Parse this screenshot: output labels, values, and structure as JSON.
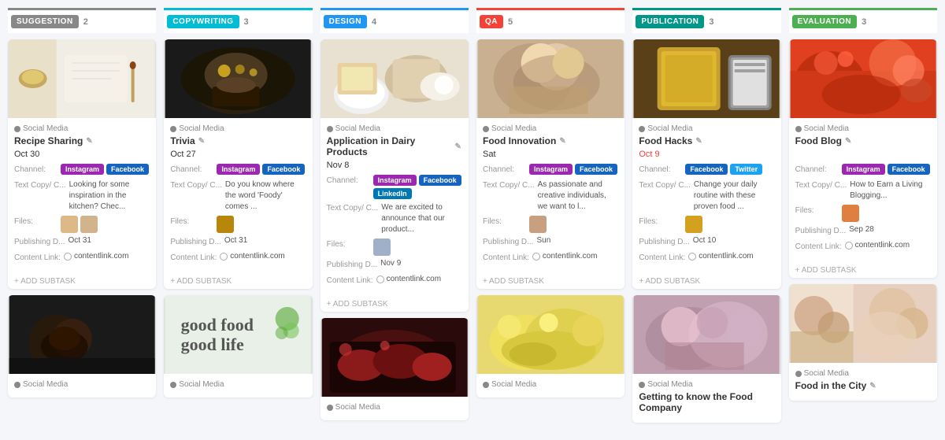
{
  "columns": [
    {
      "id": "suggestion",
      "label": "SUGGESTION",
      "count": "2",
      "colorClass": "col-suggestion",
      "cards": [
        {
          "id": "recipe-sharing",
          "image_bg": "#f5f5f0",
          "image_color": "#c8c0a0",
          "category": "Social Media",
          "title": "Recipe Sharing",
          "date": "Oct 30",
          "date_overdue": false,
          "channel_tags": [
            "Instagram",
            "Facebook"
          ],
          "text_preview": "Looking for some inspiration in the kitchen? Chec...",
          "files": [
            "thumb1",
            "thumb2"
          ],
          "publishing_date": "Oct 31",
          "content_link": "contentlink.com"
        }
      ],
      "bottom_image_bg": "#222",
      "bottom_category": "Social Media",
      "bottom_title_partial": "..."
    },
    {
      "id": "copywriting",
      "label": "COPYWRITING",
      "count": "3",
      "colorClass": "col-copywriting",
      "cards": [
        {
          "id": "trivia",
          "image_bg": "#1a1a1a",
          "category": "Social Media",
          "title": "Trivia",
          "date": "Oct 27",
          "date_overdue": false,
          "channel_tags": [
            "Instagram",
            "Facebook"
          ],
          "text_preview": "Do you know where the word 'Foody' comes ...",
          "files": [
            "thumb1"
          ],
          "publishing_date": "Oct 31",
          "content_link": "contentlink.com"
        }
      ],
      "bottom_image_bg": "#e8f4e8",
      "bottom_category": "Social Media",
      "bottom_title_partial": "..."
    },
    {
      "id": "design",
      "label": "DESIGN",
      "count": "4",
      "colorClass": "col-design",
      "cards": [
        {
          "id": "dairy-products",
          "image_bg": "#e8e0d0",
          "category": "Social Media",
          "title": "Application in Dairy Products",
          "date": "Nov 8",
          "date_overdue": false,
          "channel_tags": [
            "Instagram",
            "Facebook",
            "LinkedIn"
          ],
          "text_preview": "We are excited to announce that our product...",
          "files": [
            "thumb1"
          ],
          "publishing_date": "Nov 9",
          "content_link": "contentlink.com"
        }
      ],
      "bottom_image_bg": "#8b1a1a",
      "bottom_category": "Social Media",
      "bottom_title_partial": "..."
    },
    {
      "id": "qa",
      "label": "QA",
      "count": "5",
      "colorClass": "col-qa",
      "cards": [
        {
          "id": "food-innovation",
          "image_bg": "#d4c0b0",
          "category": "Social Media",
          "title": "Food Innovation",
          "date": "Sat",
          "date_overdue": false,
          "channel_tags": [
            "Instagram",
            "Facebook"
          ],
          "text_preview": "As passionate and creative individuals, we want to l...",
          "files": [
            "thumb1"
          ],
          "publishing_date": "Sun",
          "content_link": "contentlink.com"
        }
      ],
      "bottom_image_bg": "#f0e8c0",
      "bottom_category": "Social Media",
      "bottom_title_partial": "..."
    },
    {
      "id": "publication",
      "label": "PUBLICATION",
      "count": "3",
      "colorClass": "col-publication",
      "cards": [
        {
          "id": "food-hacks",
          "image_bg": "#c8a830",
          "category": "Social Media",
          "title": "Food Hacks",
          "date": "Oct 9",
          "date_overdue": true,
          "channel_tags": [
            "Facebook",
            "Twitter"
          ],
          "text_preview": "Change your daily routine with these proven food ...",
          "files": [
            "thumb1"
          ],
          "publishing_date": "Oct 10",
          "content_link": "contentlink.com"
        }
      ],
      "bottom_image_bg": "#c0a0c0",
      "bottom_category": "Social Media",
      "bottom_title": "Getting to know the Food Company"
    },
    {
      "id": "evaluation",
      "label": "EVALUATION",
      "count": "3",
      "colorClass": "col-evaluation",
      "cards": [
        {
          "id": "food-blog",
          "image_bg": "#e04020",
          "category": "Social Media",
          "title": "Food Blog",
          "date": "",
          "date_overdue": false,
          "channel_tags": [
            "Instagram",
            "Facebook"
          ],
          "text_preview": "How to Earn a Living Blogging...",
          "files": [
            "thumb1"
          ],
          "publishing_date": "Sep 28",
          "content_link": "contentlink.com"
        }
      ],
      "bottom_image_bg": "#e8d0c0",
      "bottom_category": "Social Media",
      "bottom_title": "Food in the City"
    }
  ],
  "labels": {
    "channel": "Channel:",
    "text_copy": "Text Copy/ C...",
    "files": "Files:",
    "publishing_date": "Publishing D...",
    "content_link": "Content Link:",
    "add_subtask": "+ ADD SUBTASK",
    "social_media": "Social Media"
  },
  "tag_colors": {
    "Instagram": "instagram",
    "Facebook": "facebook",
    "LinkedIn": "linkedin",
    "Twitter": "twitter"
  }
}
